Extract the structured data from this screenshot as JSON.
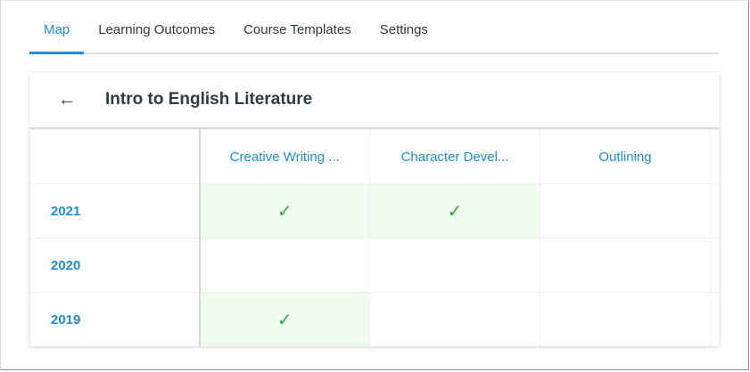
{
  "tabs": [
    {
      "label": "Map",
      "active": true
    },
    {
      "label": "Learning Outcomes"
    },
    {
      "label": "Course Templates"
    },
    {
      "label": "Settings"
    }
  ],
  "course_title": "Intro to English Literature",
  "columns": [
    "Creative Writing ...",
    "Character Devel...",
    "Outlining"
  ],
  "rows": [
    {
      "year": "2021",
      "checks": [
        true,
        true,
        false
      ]
    },
    {
      "year": "2020",
      "checks": [
        false,
        false,
        false
      ]
    },
    {
      "year": "2019",
      "checks": [
        true,
        false,
        false
      ]
    }
  ],
  "check_glyph": "✓",
  "back_glyph": "←"
}
